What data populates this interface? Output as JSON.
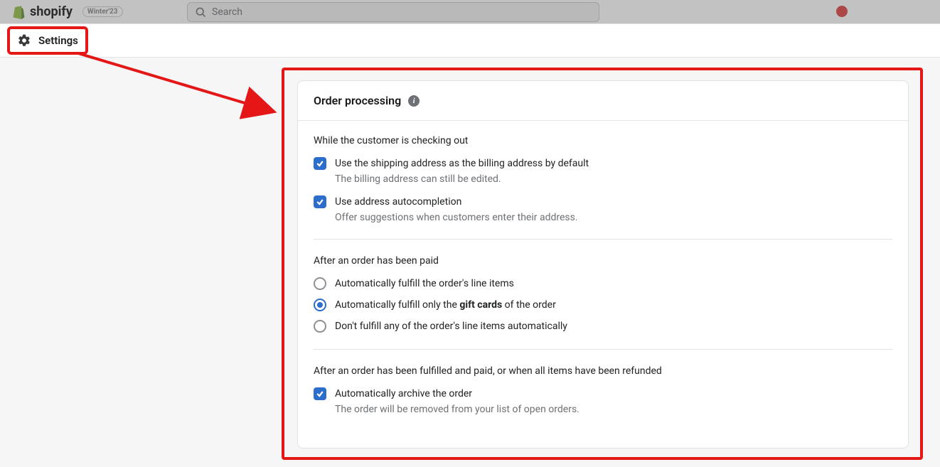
{
  "header": {
    "brand": "shopify",
    "brand_badge": "Winter'23",
    "search_placeholder": "Search"
  },
  "settings": {
    "label": "Settings"
  },
  "card": {
    "title": "Order processing",
    "section1": {
      "heading": "While the customer is checking out",
      "opt1": {
        "label": "Use the shipping address as the billing address by default",
        "help": "The billing address can still be edited."
      },
      "opt2": {
        "label": "Use address autocompletion",
        "help": "Offer suggestions when customers enter their address."
      }
    },
    "section2": {
      "heading": "After an order has been paid",
      "r1": "Automatically fulfill the order's line items",
      "r2_pre": "Automatically fulfill only the ",
      "r2_bold": "gift cards",
      "r2_post": " of the order",
      "r3": "Don't fulfill any of the order's line items automatically"
    },
    "section3": {
      "heading": "After an order has been fulfilled and paid, or when all items have been refunded",
      "opt1": {
        "label": "Automatically archive the order",
        "help": "The order will be removed from your list of open orders."
      }
    }
  }
}
